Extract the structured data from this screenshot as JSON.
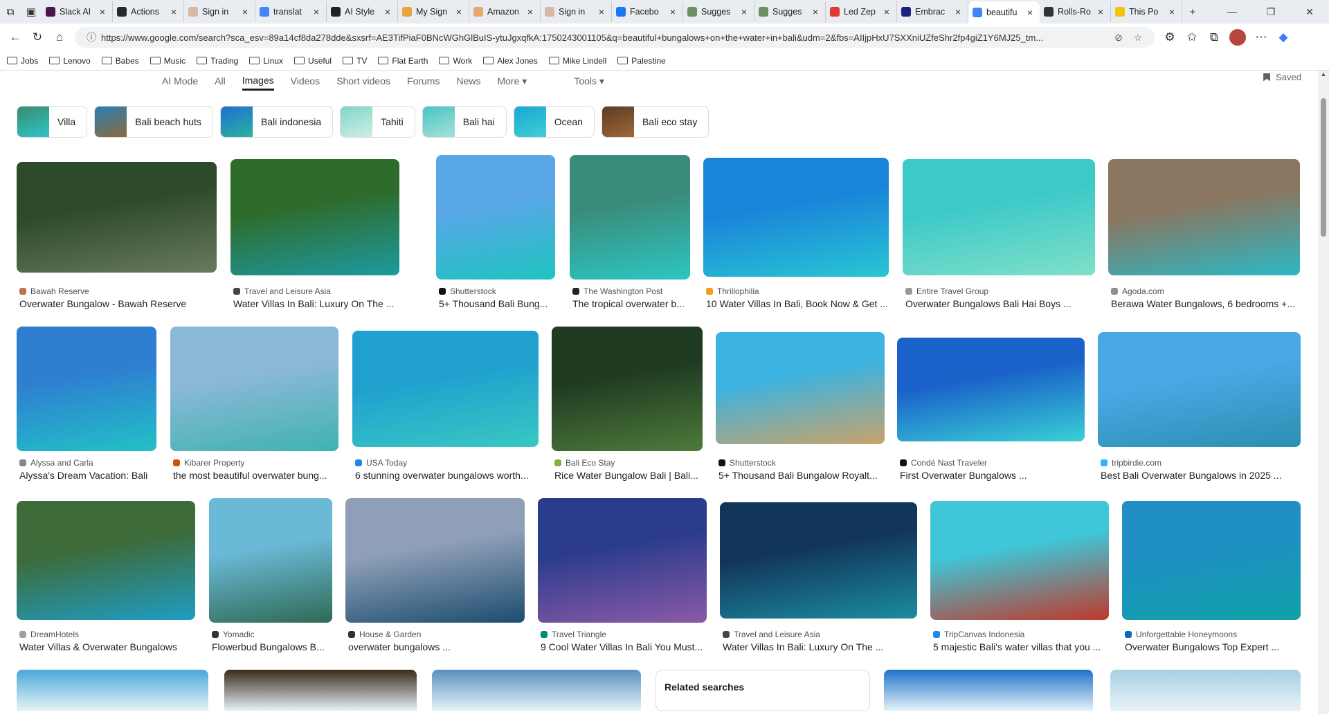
{
  "tabs": [
    {
      "title": "Slack AI",
      "fav": "#4a154b",
      "close": "×"
    },
    {
      "title": "Actions",
      "fav": "#24292e",
      "close": "×"
    },
    {
      "title": "Sign in",
      "fav": "#d9b7a5",
      "close": "×"
    },
    {
      "title": "translat",
      "fav": "#4285f4",
      "close": "×"
    },
    {
      "title": "AI Style",
      "fav": "#202124",
      "close": "×"
    },
    {
      "title": "My Sign",
      "fav": "#e8a33d",
      "close": "×"
    },
    {
      "title": "Amazon",
      "fav": "#e9a86b",
      "close": "×"
    },
    {
      "title": "Sign in",
      "fav": "#d9b7a5",
      "close": "×"
    },
    {
      "title": "Facebo",
      "fav": "#1877f2",
      "close": "×"
    },
    {
      "title": "Sugges",
      "fav": "#6b8f5e",
      "close": "×"
    },
    {
      "title": "Sugges",
      "fav": "#6b8f5e",
      "close": "×"
    },
    {
      "title": "Led Zep",
      "fav": "#e53935",
      "close": "×"
    },
    {
      "title": "Embrac",
      "fav": "#1a237e",
      "close": "×"
    },
    {
      "title": "beautifu",
      "fav": "#4285f4",
      "close": "×",
      "active": true
    },
    {
      "title": "Rolls-Ro",
      "fav": "#333333",
      "close": "×"
    },
    {
      "title": "This Po",
      "fav": "#f4c20d",
      "close": "×"
    }
  ],
  "tabstrip": {
    "new_tab": "+",
    "minimize": "—",
    "restore": "❐",
    "close": "✕"
  },
  "address": {
    "url": "https://www.google.com/search?sca_esv=89a14cf8da278dde&sxsrf=AE3TifPiaF0BNcWGhGlBuIS-ytuJgxqfkA:1750243001105&q=beautiful+bungalows+on+the+water+in+bali&udm=2&fbs=AIIjpHxU7SXXniUZfeShr2fp4giZ1Y6MJ25_tm..."
  },
  "bookmarks": [
    "Jobs",
    "Lenovo",
    "Babes",
    "Music",
    "Trading",
    "Linux",
    "Useful",
    "TV",
    "Flat Earth",
    "Work",
    "Alex Jones",
    "Mike Lindell",
    "Palestine"
  ],
  "gnav": [
    "AI Mode",
    "All",
    "Images",
    "Videos",
    "Short videos",
    "Forums",
    "News",
    "More ▾",
    "Tools ▾"
  ],
  "saved_label": "Saved",
  "chips": [
    {
      "label": "Villa",
      "c1": "#3a8b6e",
      "c2": "#2ec4c9"
    },
    {
      "label": "Bali beach huts",
      "c1": "#2a7fb5",
      "c2": "#8b6a3c"
    },
    {
      "label": "Bali indonesia",
      "c1": "#1e6fd0",
      "c2": "#2bb3a0"
    },
    {
      "label": "Tahiti",
      "c1": "#7fd6c8",
      "c2": "#cfeee5"
    },
    {
      "label": "Bali hai",
      "c1": "#48c3c7",
      "c2": "#a5e2d6"
    },
    {
      "label": "Ocean",
      "c1": "#1aa6d8",
      "c2": "#3fd0d2"
    },
    {
      "label": "Bali eco stay",
      "c1": "#5a3c22",
      "c2": "#a0673a"
    }
  ],
  "rows": [
    [
      {
        "source": "Bawah Reserve",
        "title": "Overwater Bungalow - Bawah Reserve",
        "g1": "#2d4a2a",
        "g2": "#6a7a5e",
        "fav": "#c2704a"
      },
      {
        "source": "Travel and Leisure Asia",
        "title": "Water Villas In Bali: Luxury On The ...",
        "g1": "#2f6b2b",
        "g2": "#1d9aa0",
        "fav": "#444444"
      },
      {
        "source": "Shutterstock",
        "title": "5+ Thousand Bali Bung...",
        "g1": "#5aa7e8",
        "g2": "#1fc3c0",
        "fav": "#111111"
      },
      {
        "source": "The Washington Post",
        "title": "The tropical overwater b...",
        "g1": "#3a8c7a",
        "g2": "#2dc6c4",
        "fav": "#222222"
      },
      {
        "source": "Thrillophilia",
        "title": "10 Water Villas In Bali, Book Now & Get ...",
        "g1": "#1a84d9",
        "g2": "#28c6d4",
        "fav": "#f39c12"
      },
      {
        "source": "Entire Travel Group",
        "title": "Overwater Bungalows Bali Hai Boys ...",
        "g1": "#3ec9c9",
        "g2": "#7fe0c8",
        "fav": "#999999"
      },
      {
        "source": "Agoda.com",
        "title": "Berawa Water Bungalows, 6 bedrooms +...",
        "g1": "#8a7660",
        "g2": "#2bb8c4",
        "fav": "#8e8e8e"
      }
    ],
    [
      {
        "source": "Alyssa and Carla",
        "title": "Alyssa's Dream Vacation: Bali",
        "g1": "#2e7fd1",
        "g2": "#22c1c7",
        "fav": "#888888"
      },
      {
        "source": "Kibarer Property",
        "title": "the most beautiful overwater bung...",
        "g1": "#8bb8d6",
        "g2": "#3fb3b2",
        "fav": "#d35400"
      },
      {
        "source": "USA Today",
        "title": "6 stunning overwater bungalows worth...",
        "g1": "#1fa0cf",
        "g2": "#39c8c2",
        "fav": "#1e88e5"
      },
      {
        "source": "Bali Eco Stay",
        "title": "Rice Water Bungalow Bali | Bali...",
        "g1": "#1f3b22",
        "g2": "#4e7a3a",
        "fav": "#7cb342"
      },
      {
        "source": "Shutterstock",
        "title": "5+ Thousand Bali Bungalow Royalt...",
        "g1": "#3cb3e0",
        "g2": "#c9a36a",
        "fav": "#111111"
      },
      {
        "source": "Condé Nast Traveler",
        "title": "First Overwater Bungalows ...",
        "g1": "#1a62c9",
        "g2": "#39d0d6",
        "fav": "#111111"
      },
      {
        "source": "tripbirdie.com",
        "title": "Best Bali Overwater Bungalows in 2025 ...",
        "g1": "#4aa8e6",
        "g2": "#2c8fb0",
        "fav": "#29b6f6"
      }
    ],
    [
      {
        "source": "DreamHotels",
        "title": "Water Villas & Overwater Bungalows",
        "g1": "#3d6b3a",
        "g2": "#1f9dc4",
        "fav": "#9e9e9e"
      },
      {
        "source": "Yomadic",
        "title": "Flowerbud Bungalows B...",
        "g1": "#6ab9d6",
        "g2": "#2f6a55",
        "fav": "#333333"
      },
      {
        "source": "House & Garden",
        "title": "overwater bungalows ...",
        "g1": "#8f9fb8",
        "g2": "#1c4d6e",
        "fav": "#333333"
      },
      {
        "source": "Travel Triangle",
        "title": "9 Cool Water Villas In Bali You Must...",
        "g1": "#2c3c8c",
        "g2": "#8a5aa8",
        "fav": "#00897b"
      },
      {
        "source": "Travel and Leisure Asia",
        "title": "Water Villas In Bali: Luxury On The ...",
        "g1": "#12355a",
        "g2": "#1b8ca0",
        "fav": "#444444"
      },
      {
        "source": "TripCanvas Indonesia",
        "title": "5 majestic Bali's water villas that you ...",
        "g1": "#3fc6d8",
        "g2": "#c0392b",
        "fav": "#1e88e5"
      },
      {
        "source": "Unforgettable Honeymoons",
        "title": "Overwater Bungalows Top Expert ...",
        "g1": "#1f8fc4",
        "g2": "#0fa2a8",
        "fav": "#1565c0"
      }
    ]
  ],
  "bottom_row": {
    "related": "Related searches"
  }
}
